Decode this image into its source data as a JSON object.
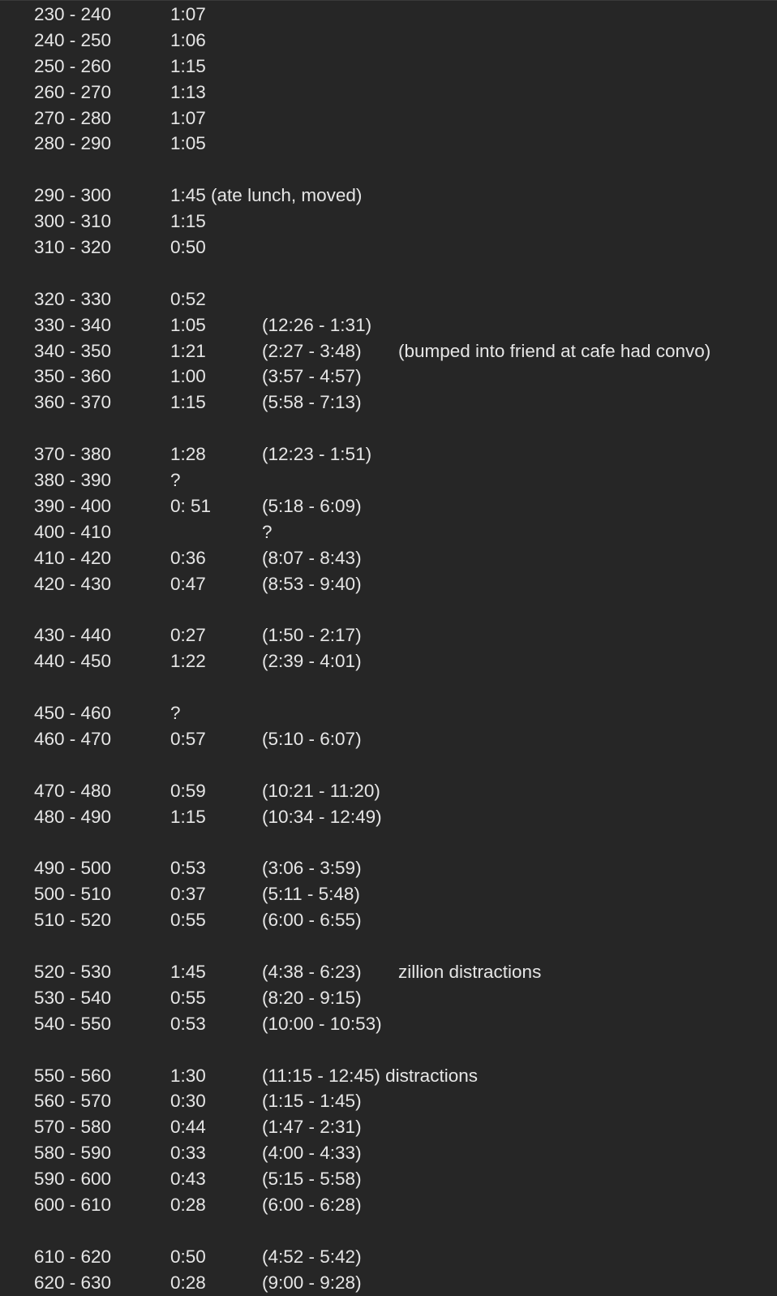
{
  "rows": [
    {
      "range": "230 - 240",
      "duration": "1:07",
      "times": "",
      "note": ""
    },
    {
      "range": "240 - 250",
      "duration": "1:06",
      "times": "",
      "note": ""
    },
    {
      "range": "250 - 260",
      "duration": "1:15",
      "times": "",
      "note": ""
    },
    {
      "range": "260 - 270",
      "duration": "1:13",
      "times": "",
      "note": ""
    },
    {
      "range": "270 - 280",
      "duration": "1:07",
      "times": "",
      "note": ""
    },
    {
      "range": "280 - 290",
      "duration": "1:05",
      "times": "",
      "note": ""
    },
    null,
    {
      "range": "290 - 300",
      "duration": "1:45 (ate lunch, moved)",
      "times": "",
      "note": ""
    },
    {
      "range": "300 - 310",
      "duration": "1:15",
      "times": "",
      "note": ""
    },
    {
      "range": "310 - 320",
      "duration": "0:50",
      "times": "",
      "note": ""
    },
    null,
    {
      "range": "320 - 330",
      "duration": "0:52",
      "times": "",
      "note": ""
    },
    {
      "range": "330 - 340",
      "duration": "1:05",
      "times": "(12:26 - 1:31)",
      "note": ""
    },
    {
      "range": "340 - 350",
      "duration": "1:21",
      "times": "(2:27 - 3:48)",
      "note": "(bumped into friend at cafe had convo)"
    },
    {
      "range": "350 - 360",
      "duration": "1:00",
      "times": "(3:57 - 4:57)",
      "note": ""
    },
    {
      "range": "360 - 370",
      "duration": "1:15",
      "times": "(5:58 - 7:13)",
      "note": ""
    },
    null,
    {
      "range": "370 - 380",
      "duration": "1:28",
      "times": "(12:23 - 1:51)",
      "note": ""
    },
    {
      "range": "380 - 390",
      "duration": "?",
      "times": "",
      "note": ""
    },
    {
      "range": "390 - 400",
      "duration": "0: 51",
      "times": "(5:18 - 6:09)",
      "note": ""
    },
    {
      "range": "400 - 410",
      "duration": "",
      "times": "?",
      "note": ""
    },
    {
      "range": "410 - 420",
      "duration": "0:36",
      "times": "(8:07 - 8:43)",
      "note": ""
    },
    {
      "range": "420 - 430",
      "duration": "0:47",
      "times": "(8:53 - 9:40)",
      "note": ""
    },
    null,
    {
      "range": "430 - 440",
      "duration": "0:27",
      "times": "(1:50 - 2:17)",
      "note": ""
    },
    {
      "range": "440 - 450",
      "duration": "1:22",
      "times": "(2:39 - 4:01)",
      "note": ""
    },
    null,
    {
      "range": "450 - 460",
      "duration": "?",
      "times": "",
      "note": ""
    },
    {
      "range": "460 - 470",
      "duration": "0:57",
      "times": "(5:10 - 6:07)",
      "note": ""
    },
    null,
    {
      "range": "470 - 480",
      "duration": "0:59",
      "times": "(10:21 - 11:20)",
      "note": ""
    },
    {
      "range": "480 - 490",
      "duration": "1:15",
      "times": "(10:34 - 12:49)",
      "note": ""
    },
    null,
    {
      "range": "490 - 500",
      "duration": "0:53",
      "times": "(3:06 - 3:59)",
      "note": ""
    },
    {
      "range": "500 - 510",
      "duration": "0:37",
      "times": "(5:11 - 5:48)",
      "note": ""
    },
    {
      "range": "510 - 520",
      "duration": "0:55",
      "times": "(6:00 - 6:55)",
      "note": ""
    },
    null,
    {
      "range": "520 - 530",
      "duration": "1:45",
      "times": "(4:38 - 6:23)",
      "note": "zillion distractions"
    },
    {
      "range": "530 - 540",
      "duration": "0:55",
      "times": "(8:20 - 9:15)",
      "note": ""
    },
    {
      "range": "540 - 550",
      "duration": "0:53",
      "times": "(10:00 - 10:53)",
      "note": ""
    },
    null,
    {
      "range": "550 - 560",
      "duration": "1:30",
      "times": "(11:15 - 12:45) distractions",
      "note": ""
    },
    {
      "range": "560 - 570",
      "duration": "0:30",
      "times": "(1:15 - 1:45)",
      "note": ""
    },
    {
      "range": "570 - 580",
      "duration": "0:44",
      "times": "(1:47 - 2:31)",
      "note": ""
    },
    {
      "range": "580 - 590",
      "duration": "0:33",
      "times": "(4:00 - 4:33)",
      "note": ""
    },
    {
      "range": "590 - 600",
      "duration": "0:43",
      "times": "(5:15 - 5:58)",
      "note": ""
    },
    {
      "range": "600 - 610",
      "duration": "0:28",
      "times": "(6:00 - 6:28)",
      "note": ""
    },
    null,
    {
      "range": "610 - 620",
      "duration": "0:50",
      "times": "(4:52 - 5:42)",
      "note": ""
    },
    {
      "range": "620 - 630",
      "duration": "0:28",
      "times": "(9:00 - 9:28)",
      "note": ""
    }
  ]
}
